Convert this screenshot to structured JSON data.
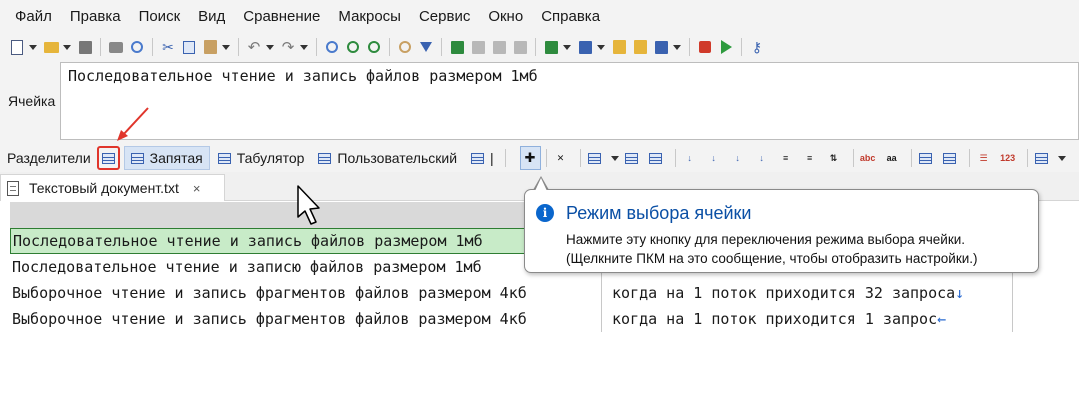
{
  "menu": [
    "Файл",
    "Правка",
    "Поиск",
    "Вид",
    "Сравнение",
    "Макросы",
    "Сервис",
    "Окно",
    "Справка"
  ],
  "toolbar": {
    "icons": [
      "new-file-icon",
      "open-folder-icon",
      "save-icon",
      "print-icon",
      "print-preview-icon",
      "cut-icon",
      "copy-icon",
      "paste-icon",
      "undo-icon",
      "redo-icon",
      "find-icon",
      "find-next-icon",
      "find-prev-icon",
      "find-files-icon",
      "filter-icon",
      "grid-view-icon",
      "grid-view-2-icon",
      "grid-view-3-icon",
      "export-icon",
      "import-icon",
      "tools-icon",
      "settings-icon",
      "calendar-check-icon",
      "stop-record-icon",
      "play-macro-icon",
      "key-icon"
    ]
  },
  "cell_editor": {
    "label": "Ячейка",
    "value": "Последовательное чтение и запись файлов размером 1мб"
  },
  "delimiters": {
    "label": "Разделители",
    "options": [
      "Запятая",
      "Табулятор",
      "Пользовательский"
    ],
    "separator": "|"
  },
  "tab": {
    "title": "Текстовый документ.txt",
    "close": "×"
  },
  "rows": [
    {
      "c1": "Последовательное чтение и запись файлов размером 1мб",
      "c2": "",
      "eol": ""
    },
    {
      "c1": "Последовательное чтение и записю файлов размером 1мб",
      "c2": "",
      "eol": ""
    },
    {
      "c1": "Выборочное чтение и запись фрагментов файлов размером 4кб",
      "c2": "когда на 1 поток приходится 32 запроса",
      "eol": "↓"
    },
    {
      "c1": "Выборочное чтение и запись фрагментов файлов размером 4кб",
      "c2": "когда  на 1 поток приходится 1 запрос",
      "eol": "←"
    }
  ],
  "tooltip": {
    "icon": "i",
    "title": "Режим выбора ячейки",
    "line1": "Нажмите эту кнопку для переключения режима выбора ячейки.",
    "line2": "(Щелкните ПКМ на это сообщение, чтобы отобразить настройки.)"
  },
  "colors": {
    "selection_fill": "#c8ebc8",
    "selection_border": "#2e7d32",
    "annotation_red": "#e0352b",
    "tooltip_title": "#0a4fa5"
  }
}
